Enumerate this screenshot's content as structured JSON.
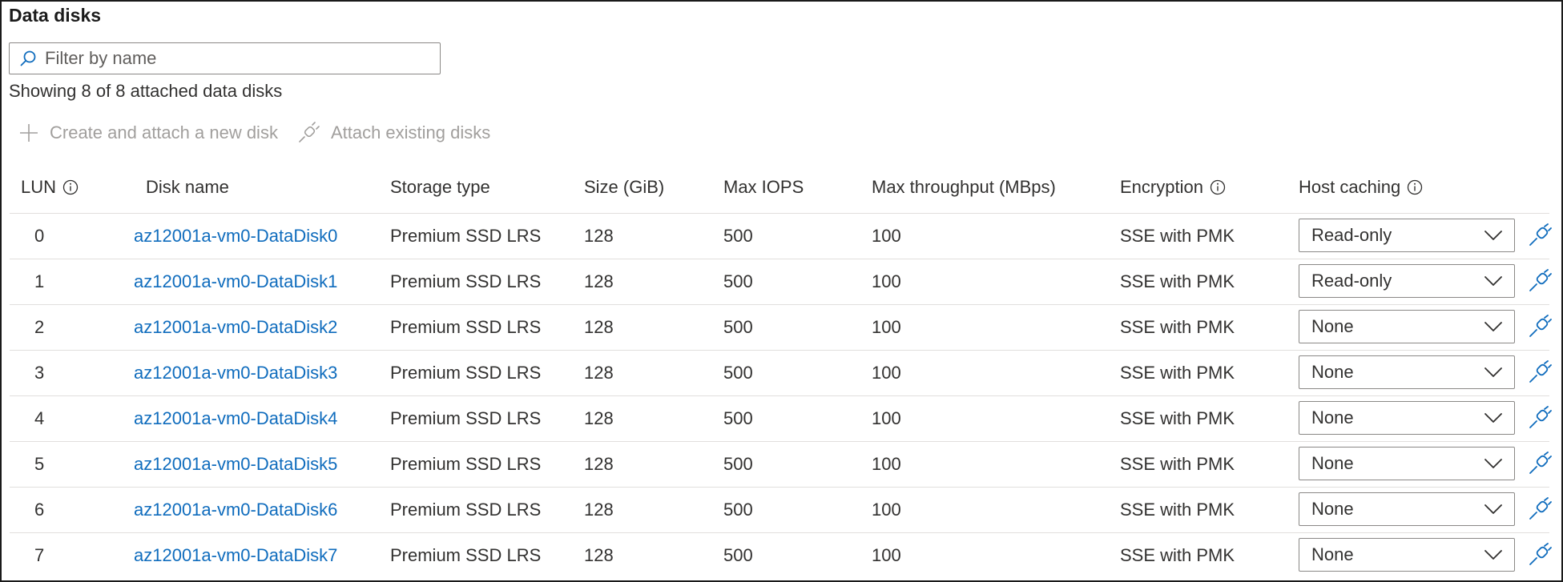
{
  "page": {
    "title": "Data disks"
  },
  "filter": {
    "placeholder": "Filter by name",
    "value": "",
    "icon": "search-icon"
  },
  "summary": {
    "showing_text": "Showing 8 of 8 attached data disks"
  },
  "toolbar": {
    "create_label": "Create and attach a new disk",
    "create_icon": "plus-icon",
    "attach_label": "Attach existing disks",
    "attach_icon": "plug-icon"
  },
  "table": {
    "headers": {
      "lun": "LUN",
      "disk_name": "Disk name",
      "storage_type": "Storage type",
      "size": "Size (GiB)",
      "max_iops": "Max IOPS",
      "max_throughput": "Max throughput (MBps)",
      "encryption": "Encryption",
      "host_caching": "Host caching"
    },
    "rows": [
      {
        "lun": "0",
        "name": "az12001a-vm0-DataDisk0",
        "storage": "Premium SSD LRS",
        "size": "128",
        "iops": "500",
        "throughput": "100",
        "encryption": "SSE with PMK",
        "caching": "Read-only"
      },
      {
        "lun": "1",
        "name": "az12001a-vm0-DataDisk1",
        "storage": "Premium SSD LRS",
        "size": "128",
        "iops": "500",
        "throughput": "100",
        "encryption": "SSE with PMK",
        "caching": "Read-only"
      },
      {
        "lun": "2",
        "name": "az12001a-vm0-DataDisk2",
        "storage": "Premium SSD LRS",
        "size": "128",
        "iops": "500",
        "throughput": "100",
        "encryption": "SSE with PMK",
        "caching": "None"
      },
      {
        "lun": "3",
        "name": "az12001a-vm0-DataDisk3",
        "storage": "Premium SSD LRS",
        "size": "128",
        "iops": "500",
        "throughput": "100",
        "encryption": "SSE with PMK",
        "caching": "None"
      },
      {
        "lun": "4",
        "name": "az12001a-vm0-DataDisk4",
        "storage": "Premium SSD LRS",
        "size": "128",
        "iops": "500",
        "throughput": "100",
        "encryption": "SSE with PMK",
        "caching": "None"
      },
      {
        "lun": "5",
        "name": "az12001a-vm0-DataDisk5",
        "storage": "Premium SSD LRS",
        "size": "128",
        "iops": "500",
        "throughput": "100",
        "encryption": "SSE with PMK",
        "caching": "None"
      },
      {
        "lun": "6",
        "name": "az12001a-vm0-DataDisk6",
        "storage": "Premium SSD LRS",
        "size": "128",
        "iops": "500",
        "throughput": "100",
        "encryption": "SSE with PMK",
        "caching": "None"
      },
      {
        "lun": "7",
        "name": "az12001a-vm0-DataDisk7",
        "storage": "Premium SSD LRS",
        "size": "128",
        "iops": "500",
        "throughput": "100",
        "encryption": "SSE with PMK",
        "caching": "None"
      }
    ]
  },
  "colors": {
    "link": "#0f6cbd",
    "accent_icon": "#0f6cbd",
    "disabled_text": "#a19f9d",
    "text": "#323130",
    "divider": "#e1dfdd"
  }
}
